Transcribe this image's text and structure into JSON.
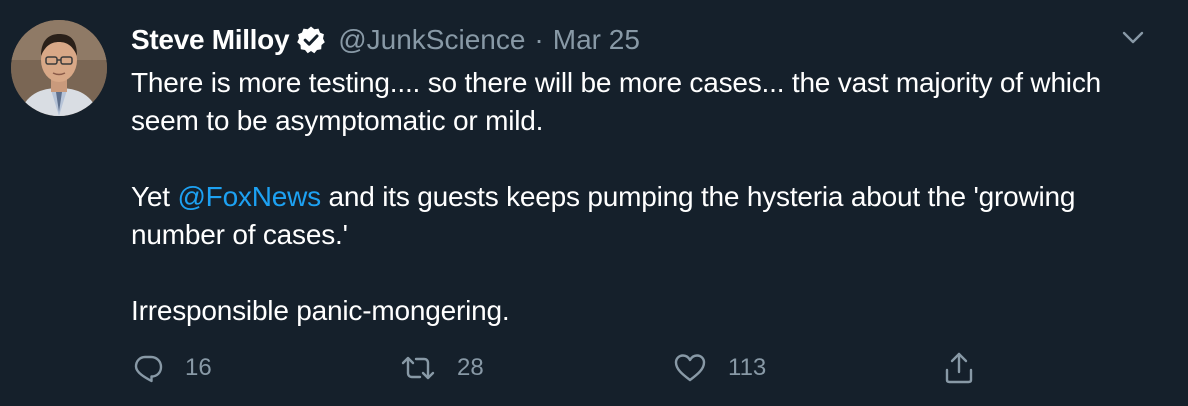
{
  "tweet": {
    "author": {
      "name": "Steve Milloy",
      "handle": "@JunkScience",
      "verified": true,
      "avatar_icon": "profile-photo"
    },
    "separator": "·",
    "date": "Mar 25",
    "text": {
      "p1": "There is more testing.... so there will be more cases... the vast majority of which seem to be asymptomatic or mild.",
      "p2_before": "Yet ",
      "p2_mention": "@FoxNews",
      "p2_after": " and its guests keeps pumping the hysteria about the 'growing number of cases.'",
      "p3": "Irresponsible panic-mongering."
    },
    "actions": {
      "reply": {
        "icon": "reply-icon",
        "count": "16"
      },
      "retweet": {
        "icon": "retweet-icon",
        "count": "28"
      },
      "like": {
        "icon": "heart-icon",
        "count": "113"
      },
      "share": {
        "icon": "share-icon"
      }
    }
  },
  "colors": {
    "background": "#15202b",
    "text": "#ffffff",
    "secondary": "#8899a6",
    "accent": "#1da1f2"
  }
}
